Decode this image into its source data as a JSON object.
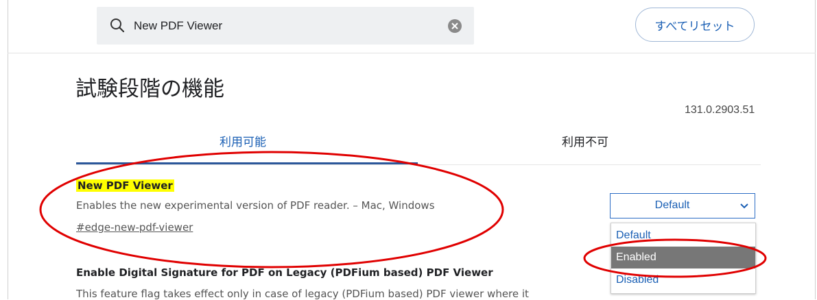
{
  "search": {
    "value": "New PDF Viewer",
    "placeholder": ""
  },
  "header": {
    "reset_label": "すべてリセット"
  },
  "page": {
    "title": "試験段階の機能",
    "version": "131.0.2903.51"
  },
  "tabs": [
    {
      "label": "利用可能",
      "selected": true
    },
    {
      "label": "利用不可",
      "selected": false
    }
  ],
  "flags": [
    {
      "title": "New PDF Viewer",
      "description": "Enables the new experimental version of PDF reader. – Mac, Windows",
      "link": "#edge-new-pdf-viewer",
      "select": {
        "value": "Default",
        "options": [
          "Default",
          "Enabled",
          "Disabled"
        ],
        "highlighted": "Enabled"
      }
    },
    {
      "title": "Enable Digital Signature for PDF on Legacy (PDFium based) PDF Viewer",
      "description": "This feature flag takes effect only in case of legacy (PDFium based) PDF viewer where it"
    }
  ],
  "colors": {
    "accent": "#1a5fb4",
    "highlight": "#ffff00",
    "annotation": "#e00000",
    "option_selected_bg": "#777777"
  }
}
